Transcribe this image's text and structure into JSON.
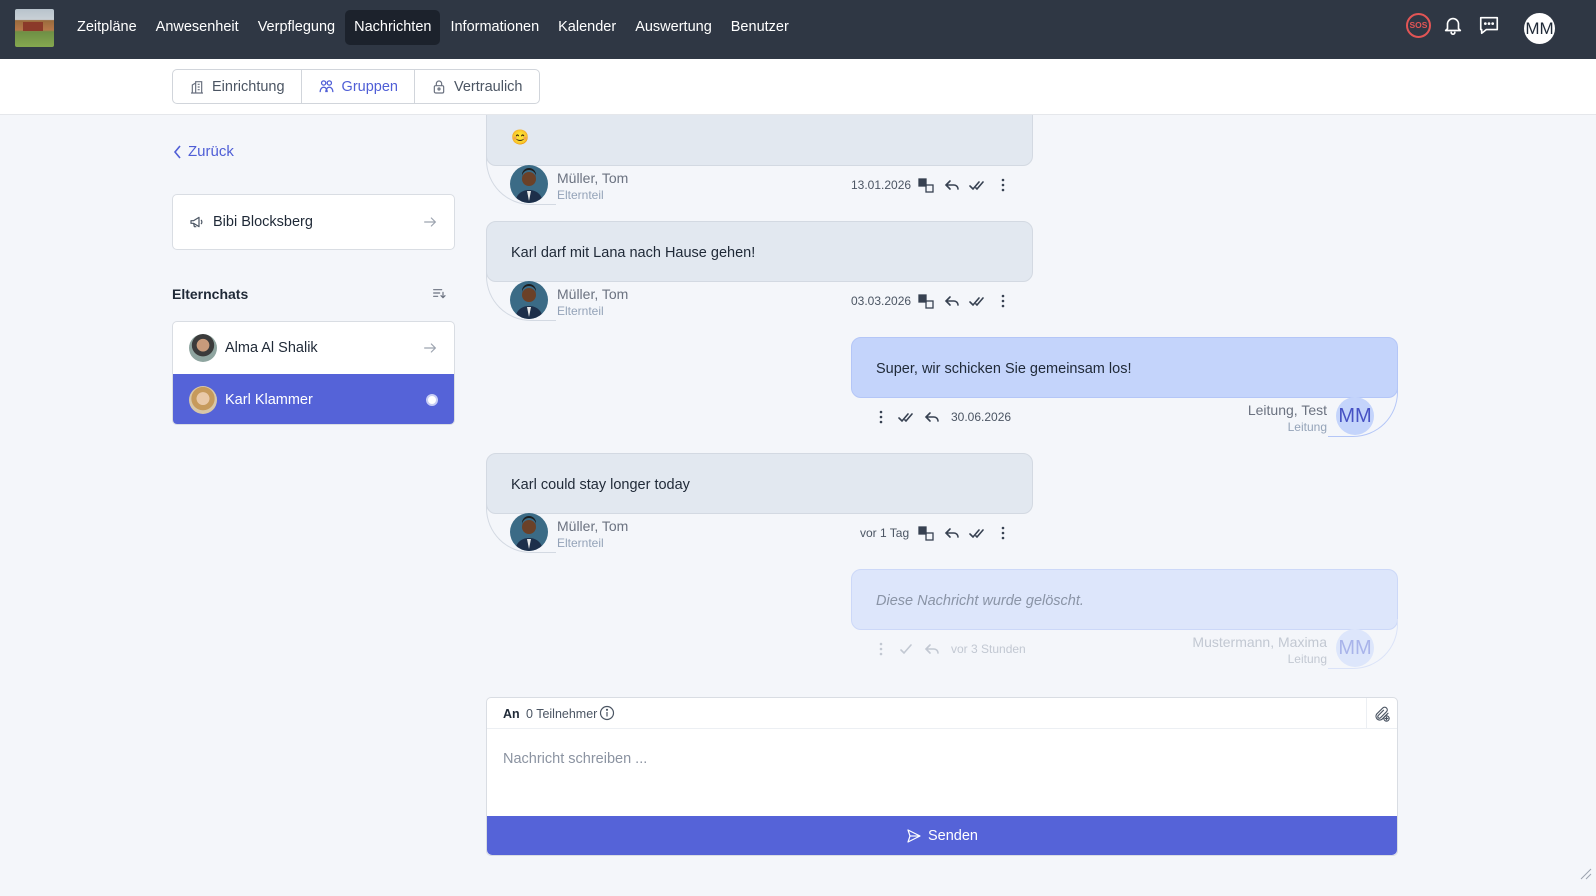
{
  "nav": {
    "items": [
      "Zeitpläne",
      "Anwesenheit",
      "Verpflegung",
      "Nachrichten",
      "Informationen",
      "Kalender",
      "Auswertung",
      "Benutzer"
    ],
    "active": "Nachrichten",
    "sos_label": "SOS",
    "user_initials": "MM"
  },
  "tabs": {
    "items": [
      "Einrichtung",
      "Gruppen",
      "Vertraulich"
    ],
    "active": "Gruppen"
  },
  "sidebar": {
    "back_label": "Zurück",
    "broadcast_label": "Bibi Blocksberg",
    "section_title": "Elternchats",
    "chats": [
      {
        "name": "Alma Al Shalik",
        "selected": false
      },
      {
        "name": "Karl Klammer",
        "selected": true
      }
    ]
  },
  "messages": [
    {
      "direction": "in",
      "text": "😊",
      "sender": "Müller, Tom",
      "role": "Elternteil",
      "date": "13.01.2026"
    },
    {
      "direction": "in",
      "text": "Karl darf mit Lana nach Hause gehen!",
      "sender": "Müller, Tom",
      "role": "Elternteil",
      "date": "03.03.2026"
    },
    {
      "direction": "out",
      "text": "Super, wir schicken Sie gemeinsam los!",
      "sender": "Leitung, Test",
      "role": "Leitung",
      "date": "30.06.2026",
      "avatar": "MM"
    },
    {
      "direction": "in",
      "text": "Karl could stay longer today",
      "sender": "Müller, Tom",
      "role": "Elternteil",
      "date": "vor 1 Tag"
    },
    {
      "direction": "out",
      "text": "Diese Nachricht wurde gelöscht.",
      "sender": "Mustermann, Maxima",
      "role": "Leitung",
      "date": "vor 3 Stunden",
      "avatar": "MM",
      "deleted": true
    }
  ],
  "composer": {
    "to_label": "An",
    "participants": "0 Teilnehmer",
    "placeholder": "Nachricht schreiben ...",
    "send_label": "Senden"
  },
  "colors": {
    "topbar": "#2f3744",
    "accent": "#5563d8",
    "incoming_bubble": "#e2e8f0",
    "outgoing_bubble": "#c4d4fb",
    "sos": "#e25555"
  }
}
